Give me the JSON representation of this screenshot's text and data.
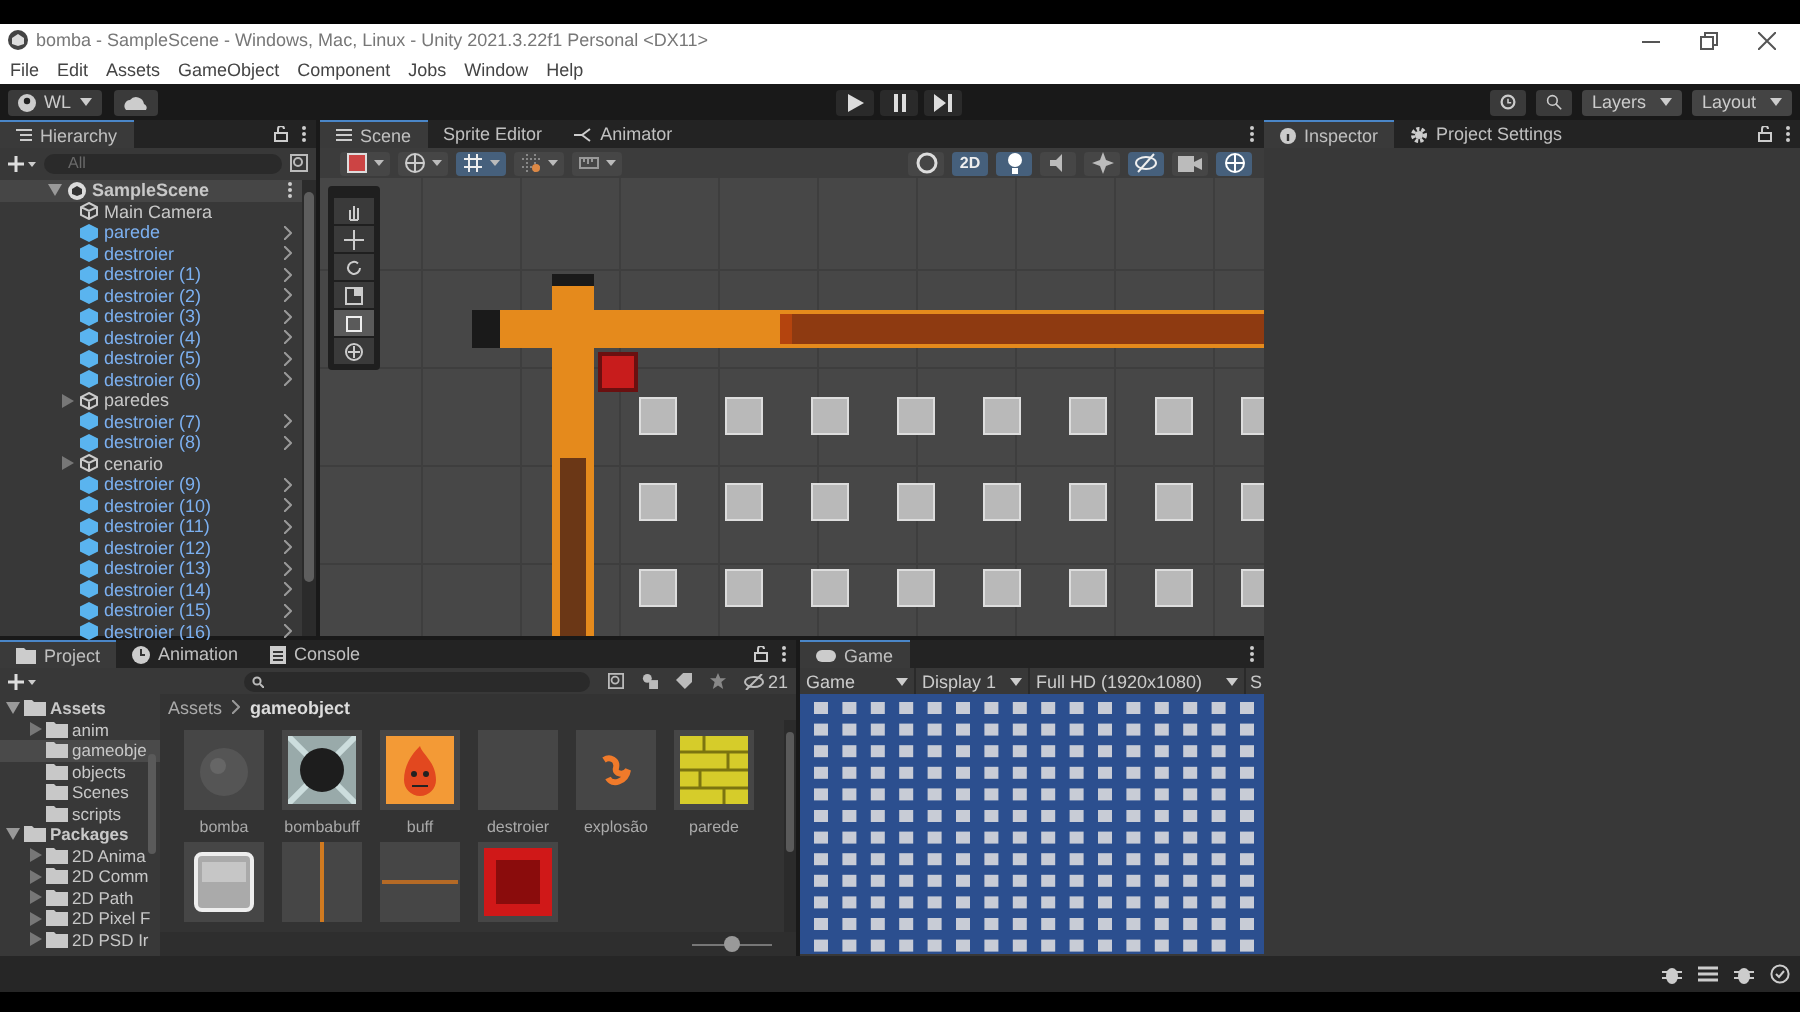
{
  "window": {
    "title": "bomba - SampleScene - Windows, Mac, Linux - Unity 2021.3.22f1 Personal <DX11>"
  },
  "menu": [
    "File",
    "Edit",
    "Assets",
    "GameObject",
    "Component",
    "Jobs",
    "Window",
    "Help"
  ],
  "toolbar": {
    "account": "WL",
    "playback": [
      {
        "kind": "play"
      },
      {
        "kind": "pause"
      },
      {
        "kind": "step"
      }
    ],
    "layers": "Layers",
    "layout": "Layout"
  },
  "hierarchy": {
    "title": "Hierarchy",
    "placeholder": "All",
    "scene": {
      "name": "SampleScene",
      "expanded": true,
      "children": [
        {
          "name": "Main Camera",
          "kind": "object"
        },
        {
          "name": "parede",
          "kind": "prefab"
        },
        {
          "name": "destroier",
          "kind": "prefab"
        },
        {
          "name": "destroier (1)",
          "kind": "prefab"
        },
        {
          "name": "destroier (2)",
          "kind": "prefab"
        },
        {
          "name": "destroier (3)",
          "kind": "prefab"
        },
        {
          "name": "destroier (4)",
          "kind": "prefab"
        },
        {
          "name": "destroier (5)",
          "kind": "prefab"
        },
        {
          "name": "destroier (6)",
          "kind": "prefab"
        },
        {
          "name": "paredes",
          "kind": "object",
          "expanded": false
        },
        {
          "name": "destroier (7)",
          "kind": "prefab"
        },
        {
          "name": "destroier (8)",
          "kind": "prefab"
        },
        {
          "name": "cenario",
          "kind": "object",
          "expanded": false
        },
        {
          "name": "destroier (9)",
          "kind": "prefab"
        },
        {
          "name": "destroier (10)",
          "kind": "prefab"
        },
        {
          "name": "destroier (11)",
          "kind": "prefab"
        },
        {
          "name": "destroier (12)",
          "kind": "prefab"
        },
        {
          "name": "destroier (13)",
          "kind": "prefab"
        },
        {
          "name": "destroier (14)",
          "kind": "prefab"
        },
        {
          "name": "destroier (15)",
          "kind": "prefab"
        },
        {
          "name": "destroier (16)",
          "kind": "prefab"
        }
      ]
    }
  },
  "scene_panel": {
    "tabs": [
      {
        "label": "Scene",
        "kind": "scene",
        "selected": true
      },
      {
        "label": "Sprite Editor",
        "kind": "plain",
        "selected": false
      },
      {
        "label": "Animator",
        "kind": "animator",
        "selected": false
      }
    ],
    "toolbar_left": [
      {
        "kind": "draw-mode",
        "on": false
      },
      {
        "kind": "globe",
        "on": false
      },
      {
        "kind": "grid",
        "on": true
      },
      {
        "kind": "snap",
        "on": false
      },
      {
        "kind": "ruler",
        "on": false
      }
    ],
    "toolbar_right": [
      {
        "kind": "circle",
        "on": false
      },
      {
        "kind": "text",
        "label": "2D",
        "on": true
      },
      {
        "kind": "bulb",
        "on": true
      },
      {
        "kind": "audio",
        "on": false
      },
      {
        "kind": "effects",
        "on": false
      },
      {
        "kind": "eye",
        "on": true
      },
      {
        "kind": "camera",
        "on": false
      },
      {
        "kind": "gizmo",
        "on": true
      }
    ],
    "tools": [
      {
        "kind": "hand",
        "selected": false
      },
      {
        "kind": "move",
        "selected": false
      },
      {
        "kind": "rotate",
        "selected": false
      },
      {
        "kind": "scale",
        "selected": false
      },
      {
        "kind": "rect",
        "selected": true
      },
      {
        "kind": "transform",
        "selected": false
      }
    ]
  },
  "inspector": {
    "tabs": [
      {
        "label": "Inspector",
        "kind": "info",
        "selected": true
      },
      {
        "label": "Project Settings",
        "kind": "gear",
        "selected": false
      }
    ]
  },
  "project": {
    "tabs": [
      {
        "label": "Project",
        "kind": "folder",
        "selected": true
      },
      {
        "label": "Animation",
        "kind": "clock",
        "selected": false
      },
      {
        "label": "Console",
        "kind": "console",
        "selected": false
      }
    ],
    "visible_count": "21",
    "tree": [
      {
        "name": "Assets",
        "expanded": true,
        "selected": false,
        "children": [
          {
            "name": "anim",
            "expanded": false,
            "selected": false
          },
          {
            "name": "gameobje",
            "selected": true
          },
          {
            "name": "objects",
            "selected": false
          },
          {
            "name": "Scenes",
            "selected": false
          },
          {
            "name": "scripts",
            "selected": false
          }
        ]
      },
      {
        "name": "Packages",
        "expanded": true,
        "selected": false,
        "children": [
          {
            "name": "2D Anima",
            "expanded": false,
            "selected": false
          },
          {
            "name": "2D Comm",
            "expanded": false,
            "selected": false
          },
          {
            "name": "2D Path",
            "expanded": false,
            "selected": false
          },
          {
            "name": "2D Pixel F",
            "expanded": false,
            "selected": false
          },
          {
            "name": "2D PSD Ir",
            "expanded": false,
            "selected": false
          }
        ]
      }
    ],
    "breadcrumb": [
      "Assets",
      "gameobject"
    ],
    "assets": [
      {
        "name": "bomba",
        "kind": "bomb"
      },
      {
        "name": "bombabuff",
        "kind": "bombframe"
      },
      {
        "name": "buff",
        "kind": "fire"
      },
      {
        "name": "destroier",
        "kind": "empty"
      },
      {
        "name": "explosão",
        "kind": "flame"
      },
      {
        "name": "parede",
        "kind": "bricks"
      },
      {
        "kind": "tile"
      },
      {
        "kind": "vline"
      },
      {
        "kind": "hline"
      },
      {
        "kind": "redblock"
      }
    ],
    "zoom": {
      "level": 0.5
    }
  },
  "game": {
    "tabs": [
      {
        "label": "Game",
        "selected": true
      }
    ],
    "mode": "Game",
    "display": "Display 1",
    "resolution": "Full HD (1920x1080)",
    "cut_label": "S"
  }
}
